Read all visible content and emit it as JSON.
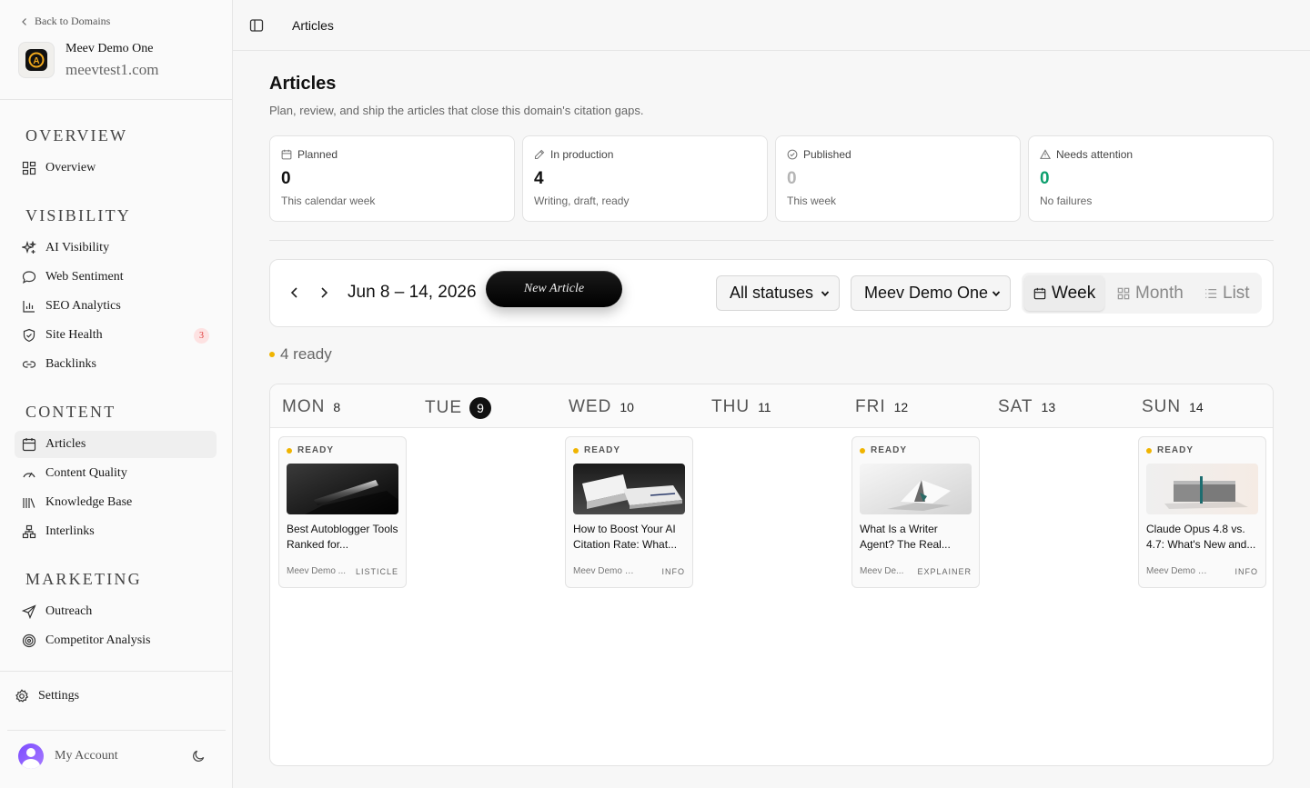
{
  "sidebar": {
    "back_label": "Back to Domains",
    "domain": {
      "name": "Meev Demo One",
      "url": "meevtest1.com",
      "logo_letter": "A"
    },
    "sections": [
      {
        "title": "OVERVIEW",
        "items": [
          {
            "label": "Overview",
            "icon": "grid-icon"
          }
        ]
      },
      {
        "title": "VISIBILITY",
        "items": [
          {
            "label": "AI Visibility",
            "icon": "sparkle-icon"
          },
          {
            "label": "Web Sentiment",
            "icon": "chat-bubble-icon"
          },
          {
            "label": "SEO Analytics",
            "icon": "bar-chart-icon"
          },
          {
            "label": "Site Health",
            "icon": "shield-icon",
            "badge": "3"
          },
          {
            "label": "Backlinks",
            "icon": "link-icon"
          }
        ]
      },
      {
        "title": "CONTENT",
        "items": [
          {
            "label": "Articles",
            "icon": "calendar-icon",
            "active": true
          },
          {
            "label": "Content Quality",
            "icon": "gauge-icon"
          },
          {
            "label": "Knowledge Base",
            "icon": "library-icon"
          },
          {
            "label": "Interlinks",
            "icon": "network-icon"
          }
        ]
      },
      {
        "title": "MARKETING",
        "items": [
          {
            "label": "Outreach",
            "icon": "send-icon"
          },
          {
            "label": "Competitor Analysis",
            "icon": "target-icon"
          }
        ]
      }
    ],
    "settings_label": "Settings",
    "account_label": "My Account"
  },
  "topbar": {
    "title": "Articles"
  },
  "main": {
    "title": "Articles",
    "subtitle": "Plan, review, and ship the articles that close this domain's citation gaps.",
    "stats": [
      {
        "label": "Planned",
        "value": "0",
        "desc": "This calendar week",
        "icon": "calendar-icon",
        "value_color": "#111111"
      },
      {
        "label": "In production",
        "value": "4",
        "desc": "Writing, draft, ready",
        "icon": "pencil-icon",
        "value_color": "#111111"
      },
      {
        "label": "Published",
        "value": "0",
        "desc": "This week",
        "icon": "check-circle-icon",
        "value_color": "#b5b5b5"
      },
      {
        "label": "Needs attention",
        "value": "0",
        "desc": "No failures",
        "icon": "warning-icon",
        "value_color": "#0e9f6e"
      }
    ],
    "toolbar": {
      "range": "Jun 8 – 14, 2026",
      "new_article": "New Article",
      "status_select": "All statuses",
      "domain_select": "Meev Demo One",
      "views": [
        {
          "label": "Week",
          "icon": "calendar-icon",
          "active": true
        },
        {
          "label": "Month",
          "icon": "grid-icon",
          "active": false
        },
        {
          "label": "List",
          "icon": "list-icon",
          "active": false
        }
      ]
    },
    "ready_count": "4 ready",
    "status_color": "#f0b400",
    "days": [
      {
        "name": "MON",
        "num": "8"
      },
      {
        "name": "TUE",
        "num": "9",
        "today": true
      },
      {
        "name": "WED",
        "num": "10"
      },
      {
        "name": "THU",
        "num": "11"
      },
      {
        "name": "FRI",
        "num": "12"
      },
      {
        "name": "SAT",
        "num": "13"
      },
      {
        "name": "SUN",
        "num": "14"
      }
    ],
    "articles": [
      {
        "day": 0,
        "status": "READY",
        "title": "Best Autoblogger Tools Ranked for...",
        "publisher": "Meev Demo ...",
        "type": "LISTICLE",
        "thumb": "dark-pen"
      },
      {
        "day": 2,
        "status": "READY",
        "title": "How to Boost Your AI Citation Rate: What...",
        "publisher": "Meev Demo One",
        "type": "INFO",
        "thumb": "paper-stack"
      },
      {
        "day": 4,
        "status": "READY",
        "title": "What Is a Writer Agent? The Real...",
        "publisher": "Meev De...",
        "type": "EXPLAINER",
        "thumb": "folded-card"
      },
      {
        "day": 6,
        "status": "READY",
        "title": "Claude Opus 4.8 vs. 4.7: What's New and...",
        "publisher": "Meev Demo One",
        "type": "INFO",
        "thumb": "grey-blocks"
      }
    ]
  }
}
